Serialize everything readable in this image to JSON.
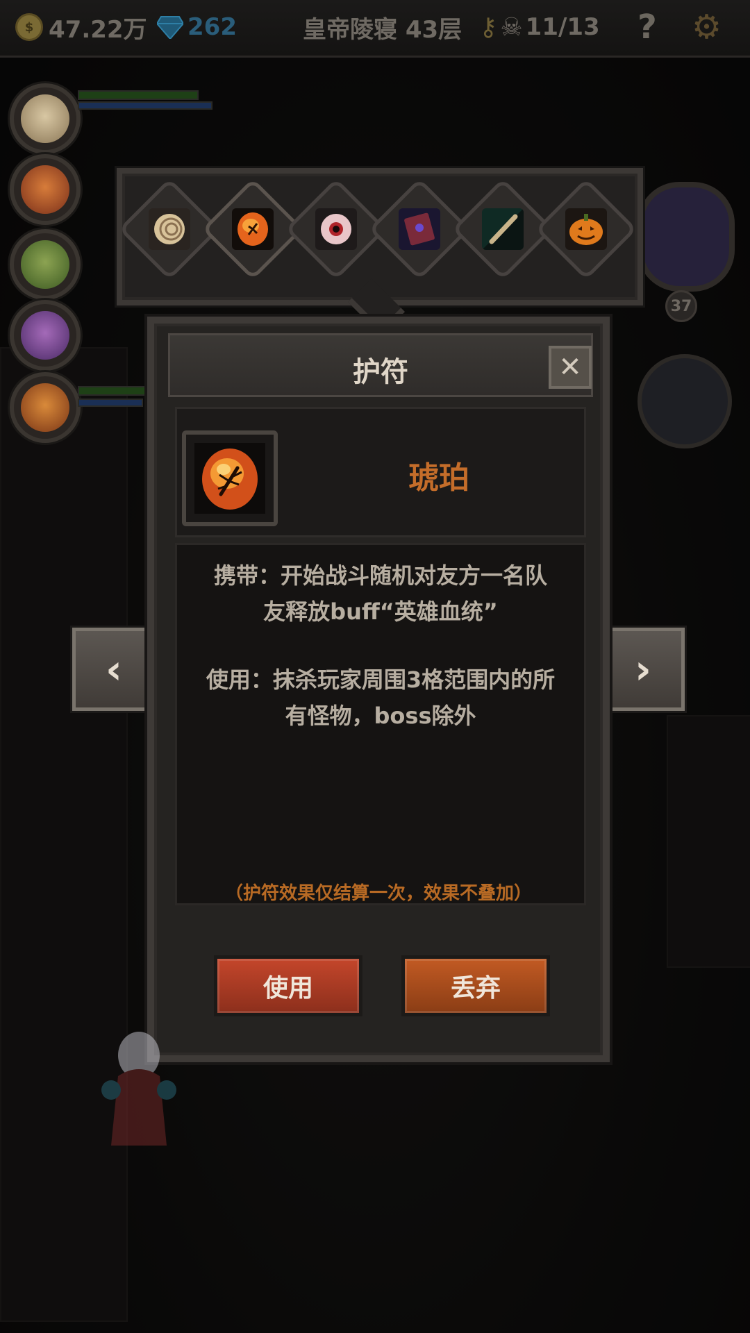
{
  "topbar": {
    "gold": "47.22万",
    "gems": "262",
    "location": "皇帝陵寝 43层",
    "kills": "11/13",
    "help_glyph": "?",
    "icons": [
      "coin-icon",
      "gem-icon",
      "key-icon",
      "skull-icon",
      "help-icon",
      "settings-icon"
    ]
  },
  "boss": {
    "level": "37"
  },
  "amulet_tray": {
    "slots": [
      {
        "name": "shell"
      },
      {
        "name": "amber",
        "selected": true
      },
      {
        "name": "eyeball"
      },
      {
        "name": "spellbook"
      },
      {
        "name": "flute"
      },
      {
        "name": "pumpkin"
      }
    ]
  },
  "dialog": {
    "title": "护符",
    "close_glyph": "✕",
    "item_name": "琥珀",
    "carry_line1": "携带：开始战斗随机对友方一名队",
    "carry_line2": "友释放buff“英雄血统”",
    "use_line1": "使用：抹杀玩家周围3格范围内的所",
    "use_line2": "有怪物，boss除外",
    "note": "（护符效果仅结算一次，效果不叠加）",
    "use_button": "使用",
    "discard_button": "丢弃"
  },
  "nav": {
    "prev": "‹",
    "next": "›"
  },
  "colors": {
    "item_name": "#c46d2a",
    "note": "#b86a24",
    "use_button": "#b03f27",
    "discard_button": "#b0511f",
    "hp": "#2e6b1f",
    "mp": "#1f3e7a"
  }
}
